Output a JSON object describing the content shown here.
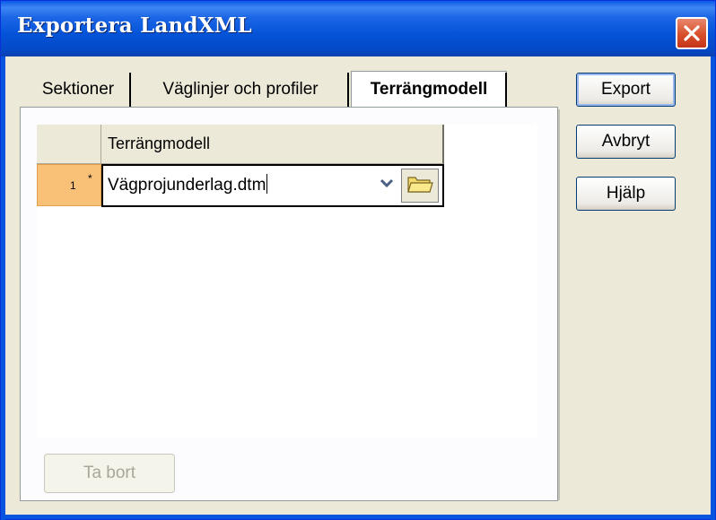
{
  "window": {
    "title": "Exportera LandXML"
  },
  "tabs": [
    {
      "label": "Sektioner",
      "active": false
    },
    {
      "label": "Väglinjer och profiler",
      "active": false
    },
    {
      "label": "Terrängmodell",
      "active": true
    }
  ],
  "grid": {
    "column_header": "Terrängmodell",
    "rows": [
      {
        "row_number": "1",
        "new_row_marker": "*",
        "value": "Vägprojunderlag.dtm"
      }
    ]
  },
  "delete_button": {
    "label": "Ta bort",
    "enabled": false
  },
  "actions": {
    "export_label": "Export",
    "cancel_label": "Avbryt",
    "help_label": "Hjälp"
  },
  "icons": {
    "close": "close-icon",
    "dropdown": "chevron-down-icon",
    "folder": "folder-open-icon"
  },
  "colors": {
    "titlebar": "#0453d8",
    "close_button": "#d8502a",
    "row_header": "#f9c078",
    "dialog_bg": "#ece9d8"
  }
}
